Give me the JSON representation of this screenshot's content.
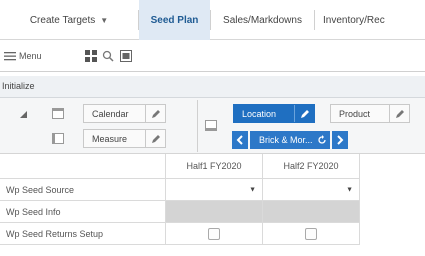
{
  "tabs": [
    {
      "label": "Create Targets",
      "has_caret": true,
      "active": false
    },
    {
      "label": "Seed Plan",
      "active": true
    },
    {
      "label": "Sales/Markdowns",
      "active": false
    },
    {
      "label": "Inventory/Rec",
      "active": false
    }
  ],
  "toolbar": {
    "menu_label": "Menu"
  },
  "initialize": {
    "label": "Initialize"
  },
  "pivot": {
    "calendar_label": "Calendar",
    "measure_label": "Measure",
    "location_label": "Location",
    "product_label": "Product",
    "location_value": "Brick & Mor..."
  },
  "grid": {
    "columns": [
      "Half1 FY2020",
      "Half2 FY2020"
    ],
    "rows": [
      {
        "label": "Wp Seed Source",
        "type": "dropdown"
      },
      {
        "label": "Wp Seed Info",
        "type": "readonly"
      },
      {
        "label": "Wp Seed Returns Setup",
        "type": "checkbox"
      }
    ]
  }
}
